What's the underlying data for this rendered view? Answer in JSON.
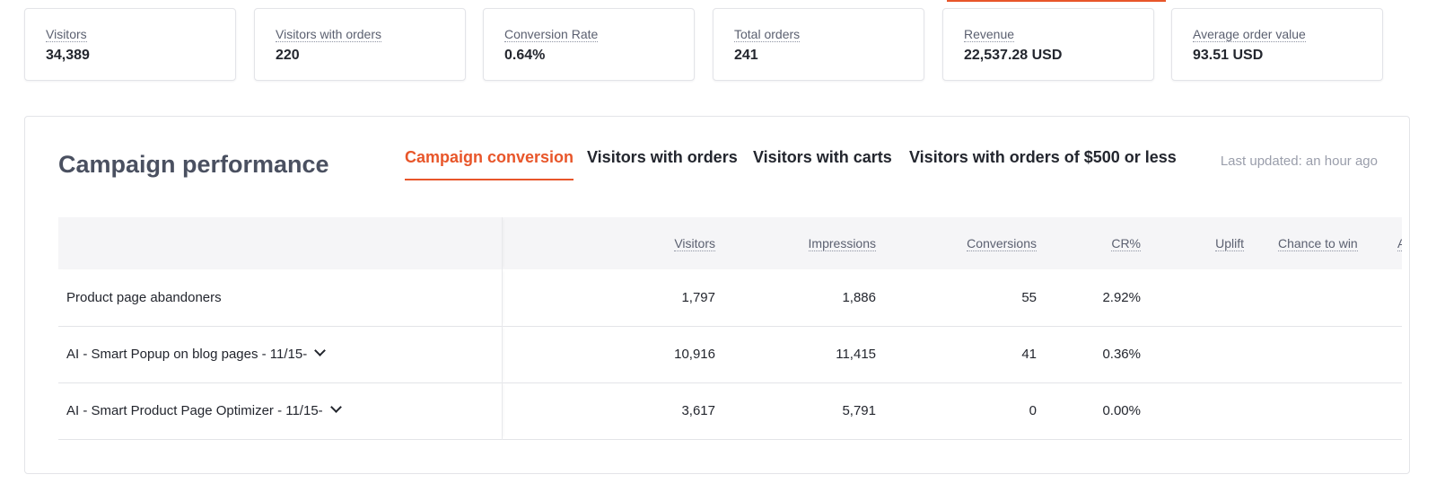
{
  "kpis": [
    {
      "label": "Visitors",
      "value": "34,389"
    },
    {
      "label": "Visitors with orders",
      "value": "220"
    },
    {
      "label": "Conversion Rate",
      "value": "0.64%"
    },
    {
      "label": "Total orders",
      "value": "241"
    },
    {
      "label": "Revenue",
      "value": "22,537.28 USD"
    },
    {
      "label": "Average order value",
      "value": "93.51 USD"
    }
  ],
  "panel": {
    "title": "Campaign performance",
    "tabs": [
      {
        "label": "Campaign conversion",
        "active": true
      },
      {
        "label": "Visitors with orders",
        "active": false
      },
      {
        "label": "Visitors with carts",
        "active": false
      },
      {
        "label": "Visitors with orders of $500 or less",
        "active": false
      }
    ],
    "last_updated": "Last updated: an hour ago"
  },
  "table": {
    "columns": [
      "",
      "Visitors",
      "Impressions",
      "Conversions",
      "CR%",
      "Uplift",
      "Chance to win",
      "A"
    ],
    "rows": [
      {
        "name": "Product page abandoners",
        "visitors": "1,797",
        "impressions": "1,886",
        "conversions": "55",
        "cr": "2.92%",
        "uplift": "",
        "chance": "",
        "expandable": false
      },
      {
        "name": "AI - Smart Popup on blog pages - 11/15-",
        "visitors": "10,916",
        "impressions": "11,415",
        "conversions": "41",
        "cr": "0.36%",
        "uplift": "",
        "chance": "",
        "expandable": true
      },
      {
        "name": "AI - Smart Product Page Optimizer - 11/15-",
        "visitors": "3,617",
        "impressions": "5,791",
        "conversions": "0",
        "cr": "0.00%",
        "uplift": "",
        "chance": "",
        "expandable": true
      }
    ]
  },
  "colors": {
    "accent": "#e8562a",
    "text": "#23262e",
    "muted": "#9a9eab",
    "border": "#e3e4e8"
  }
}
